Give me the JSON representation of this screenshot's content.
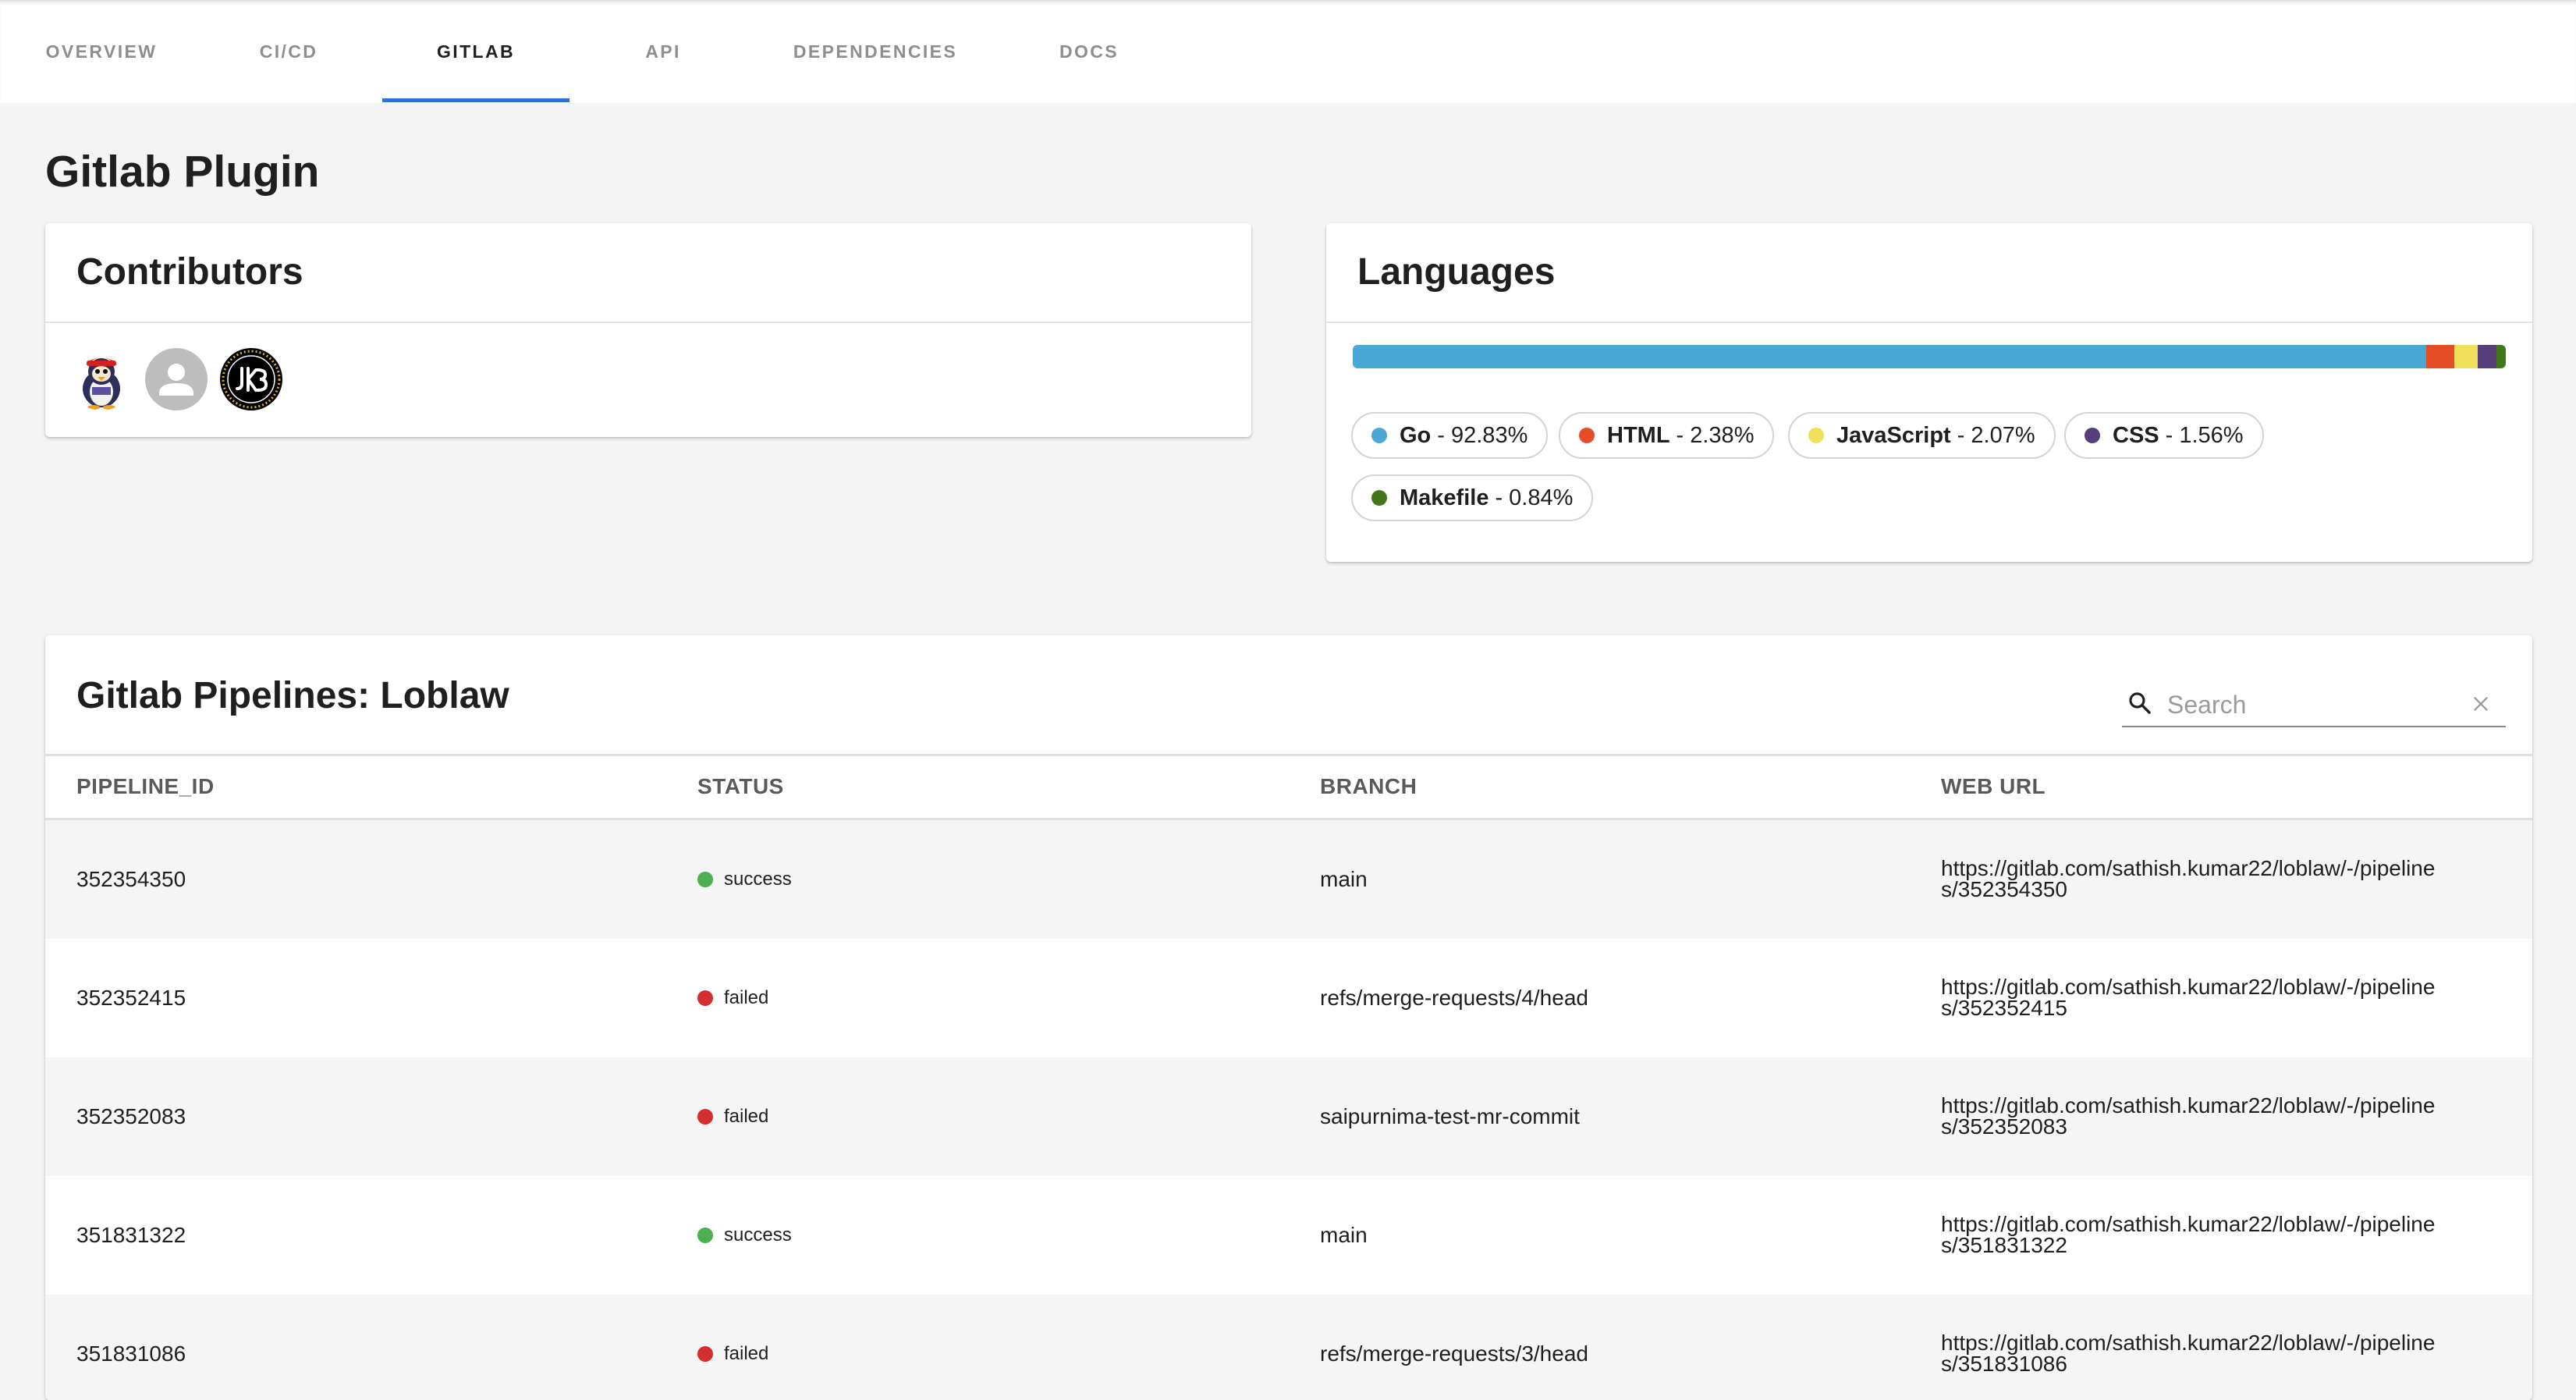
{
  "tabs": [
    {
      "label": "OVERVIEW",
      "active": false
    },
    {
      "label": "CI/CD",
      "active": false
    },
    {
      "label": "GITLAB",
      "active": true
    },
    {
      "label": "API",
      "active": false
    },
    {
      "label": "DEPENDENCIES",
      "active": false
    },
    {
      "label": "DOCS",
      "active": false
    }
  ],
  "page": {
    "title": "Gitlab Plugin"
  },
  "contributors": {
    "title": "Contributors",
    "avatars": [
      {
        "name": "penguin-avatar",
        "icon": "penguin-mascot"
      },
      {
        "name": "default-avatar",
        "icon": "person-silhouette"
      },
      {
        "name": "jk-avatar",
        "icon": "JK3-logo"
      }
    ]
  },
  "languages": {
    "title": "Languages",
    "items": [
      {
        "name": "Go",
        "percent_label": "- 92.83%",
        "value": 92.83,
        "color": "#4aa8d6"
      },
      {
        "name": "HTML",
        "percent_label": "- 2.38%",
        "value": 2.38,
        "color": "#e44d26"
      },
      {
        "name": "JavaScript",
        "percent_label": "- 2.07%",
        "value": 2.07,
        "color": "#f1e05a"
      },
      {
        "name": "CSS",
        "percent_label": "- 1.56%",
        "value": 1.56,
        "color": "#563d7c"
      },
      {
        "name": "Makefile",
        "percent_label": "- 0.84%",
        "value": 0.84,
        "color": "#427819"
      }
    ]
  },
  "pipelines": {
    "title": "Gitlab Pipelines: Loblaw",
    "search_placeholder": "Search",
    "columns": [
      "PIPELINE_ID",
      "STATUS",
      "BRANCH",
      "WEB URL"
    ],
    "rows": [
      {
        "id": "352354350",
        "status": "success",
        "branch": "main",
        "url": "https://gitlab.com/sathish.kumar22/loblaw/-/pipelines/352354350"
      },
      {
        "id": "352352415",
        "status": "failed",
        "branch": "refs/merge-requests/4/head",
        "url": "https://gitlab.com/sathish.kumar22/loblaw/-/pipelines/352352415"
      },
      {
        "id": "352352083",
        "status": "failed",
        "branch": "saipurnima-test-mr-commit",
        "url": "https://gitlab.com/sathish.kumar22/loblaw/-/pipelines/352352083"
      },
      {
        "id": "351831322",
        "status": "success",
        "branch": "main",
        "url": "https://gitlab.com/sathish.kumar22/loblaw/-/pipelines/351831322"
      },
      {
        "id": "351831086",
        "status": "failed",
        "branch": "refs/merge-requests/3/head",
        "url": "https://gitlab.com/sathish.kumar22/loblaw/-/pipelines/351831086"
      }
    ]
  },
  "colors": {
    "success": "#4caf50",
    "failed": "#d32f2f",
    "tab_indicator": "#2f6fdb"
  }
}
